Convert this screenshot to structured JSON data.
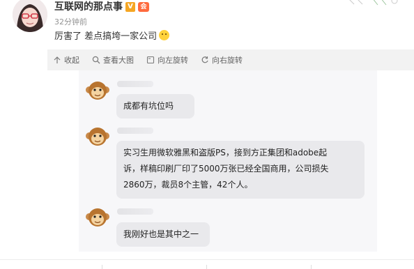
{
  "post": {
    "author": "互联网的那点事",
    "verified_mark": "V",
    "member_mark": "会",
    "time": "32分钟前",
    "text": "厉害了 差点搞垮一家公司"
  },
  "toolbar": {
    "collapse_label": "收起",
    "view_large_label": "查看大图",
    "rotate_left_label": "向左旋转",
    "rotate_right_label": "向右旋转"
  },
  "chat": {
    "messages": [
      {
        "text": "成都有坑位吗"
      },
      {
        "lines": [
          "实习生用微软雅黑和盗版PS，接到方正集团和adobe起",
          "诉，样稿印刷厂印了5000万张已经全国商用，公司损失",
          "2860万，裁员8个主管，42个人。"
        ]
      },
      {
        "text": "我刚好也是其中之一"
      }
    ]
  },
  "colors": {
    "toolbar_bg": "#f2f2f2",
    "bubble_bg": "#e9e9ec",
    "verified": "#f5a623",
    "member": "#ff6a3d"
  },
  "icons": [
    "arrow-up-icon",
    "search-icon",
    "rotate-left-icon",
    "rotate-right-icon",
    "monkey-avatar-icon",
    "emoji-icon"
  ]
}
